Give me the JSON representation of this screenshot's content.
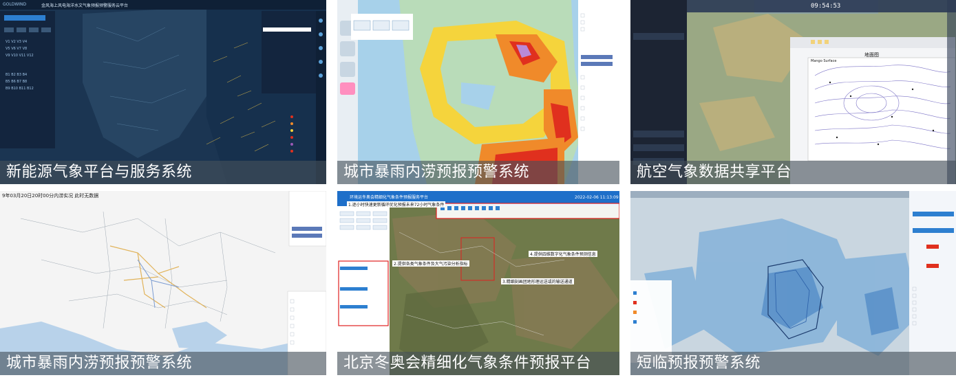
{
  "tiles": [
    {
      "caption": "新能源气象平台与服务系统",
      "logo": "GOLDWIND",
      "header_title": "金风海上风电海洋水文气象预报预警服务云平台",
      "colors": {
        "bg": "#1b3552",
        "panel": "#13253d",
        "accent": "#2d7fd0"
      }
    },
    {
      "caption": "城市暴雨内涝预报预警系统",
      "colors": {
        "water": "#a7d1ea",
        "land": "#b9dcb9",
        "yellow": "#f5d43c",
        "orange": "#f08a2a",
        "red": "#e0301e"
      }
    },
    {
      "caption": "航空气象数据共享平台",
      "clock": "09:54:53",
      "chart_title": "地面图",
      "chart_sub": "Mango Surface",
      "colors": {
        "sidebar": "#1c2433",
        "map": "#8a9e78"
      }
    },
    {
      "caption": "城市暴雨内涝预报预警系统",
      "header_text": "9年03月20日20时00分内涝实况 此时无数据",
      "colors": {
        "sea": "#b8d2ea",
        "land": "#f4f4f4",
        "road": "#e1b35a"
      }
    },
    {
      "caption": "北京冬奥会精细化气象条件预报平台",
      "header_title": "环境运冬奥会精细化气象条件预报服务平台",
      "datetime": "2022-02-06 11:13:09",
      "callouts": [
        "1.逐小时快速更新循环优化预报未来72小时气象条件",
        "2.提供各类气象条件及大气污染分析指标",
        "3.精细刻画团地形理运送或的输送通道",
        "4.提供四维数字化气象条件预测信息"
      ],
      "colors": {
        "header": "#1e6fc9",
        "satellite": "#6f7a4a",
        "red": "#e02020"
      }
    },
    {
      "caption": "短临预报预警系统",
      "colors": {
        "land": "#c9d6e0",
        "rain": "#5f9fd6",
        "panel": "#f3f6fa"
      }
    }
  ]
}
